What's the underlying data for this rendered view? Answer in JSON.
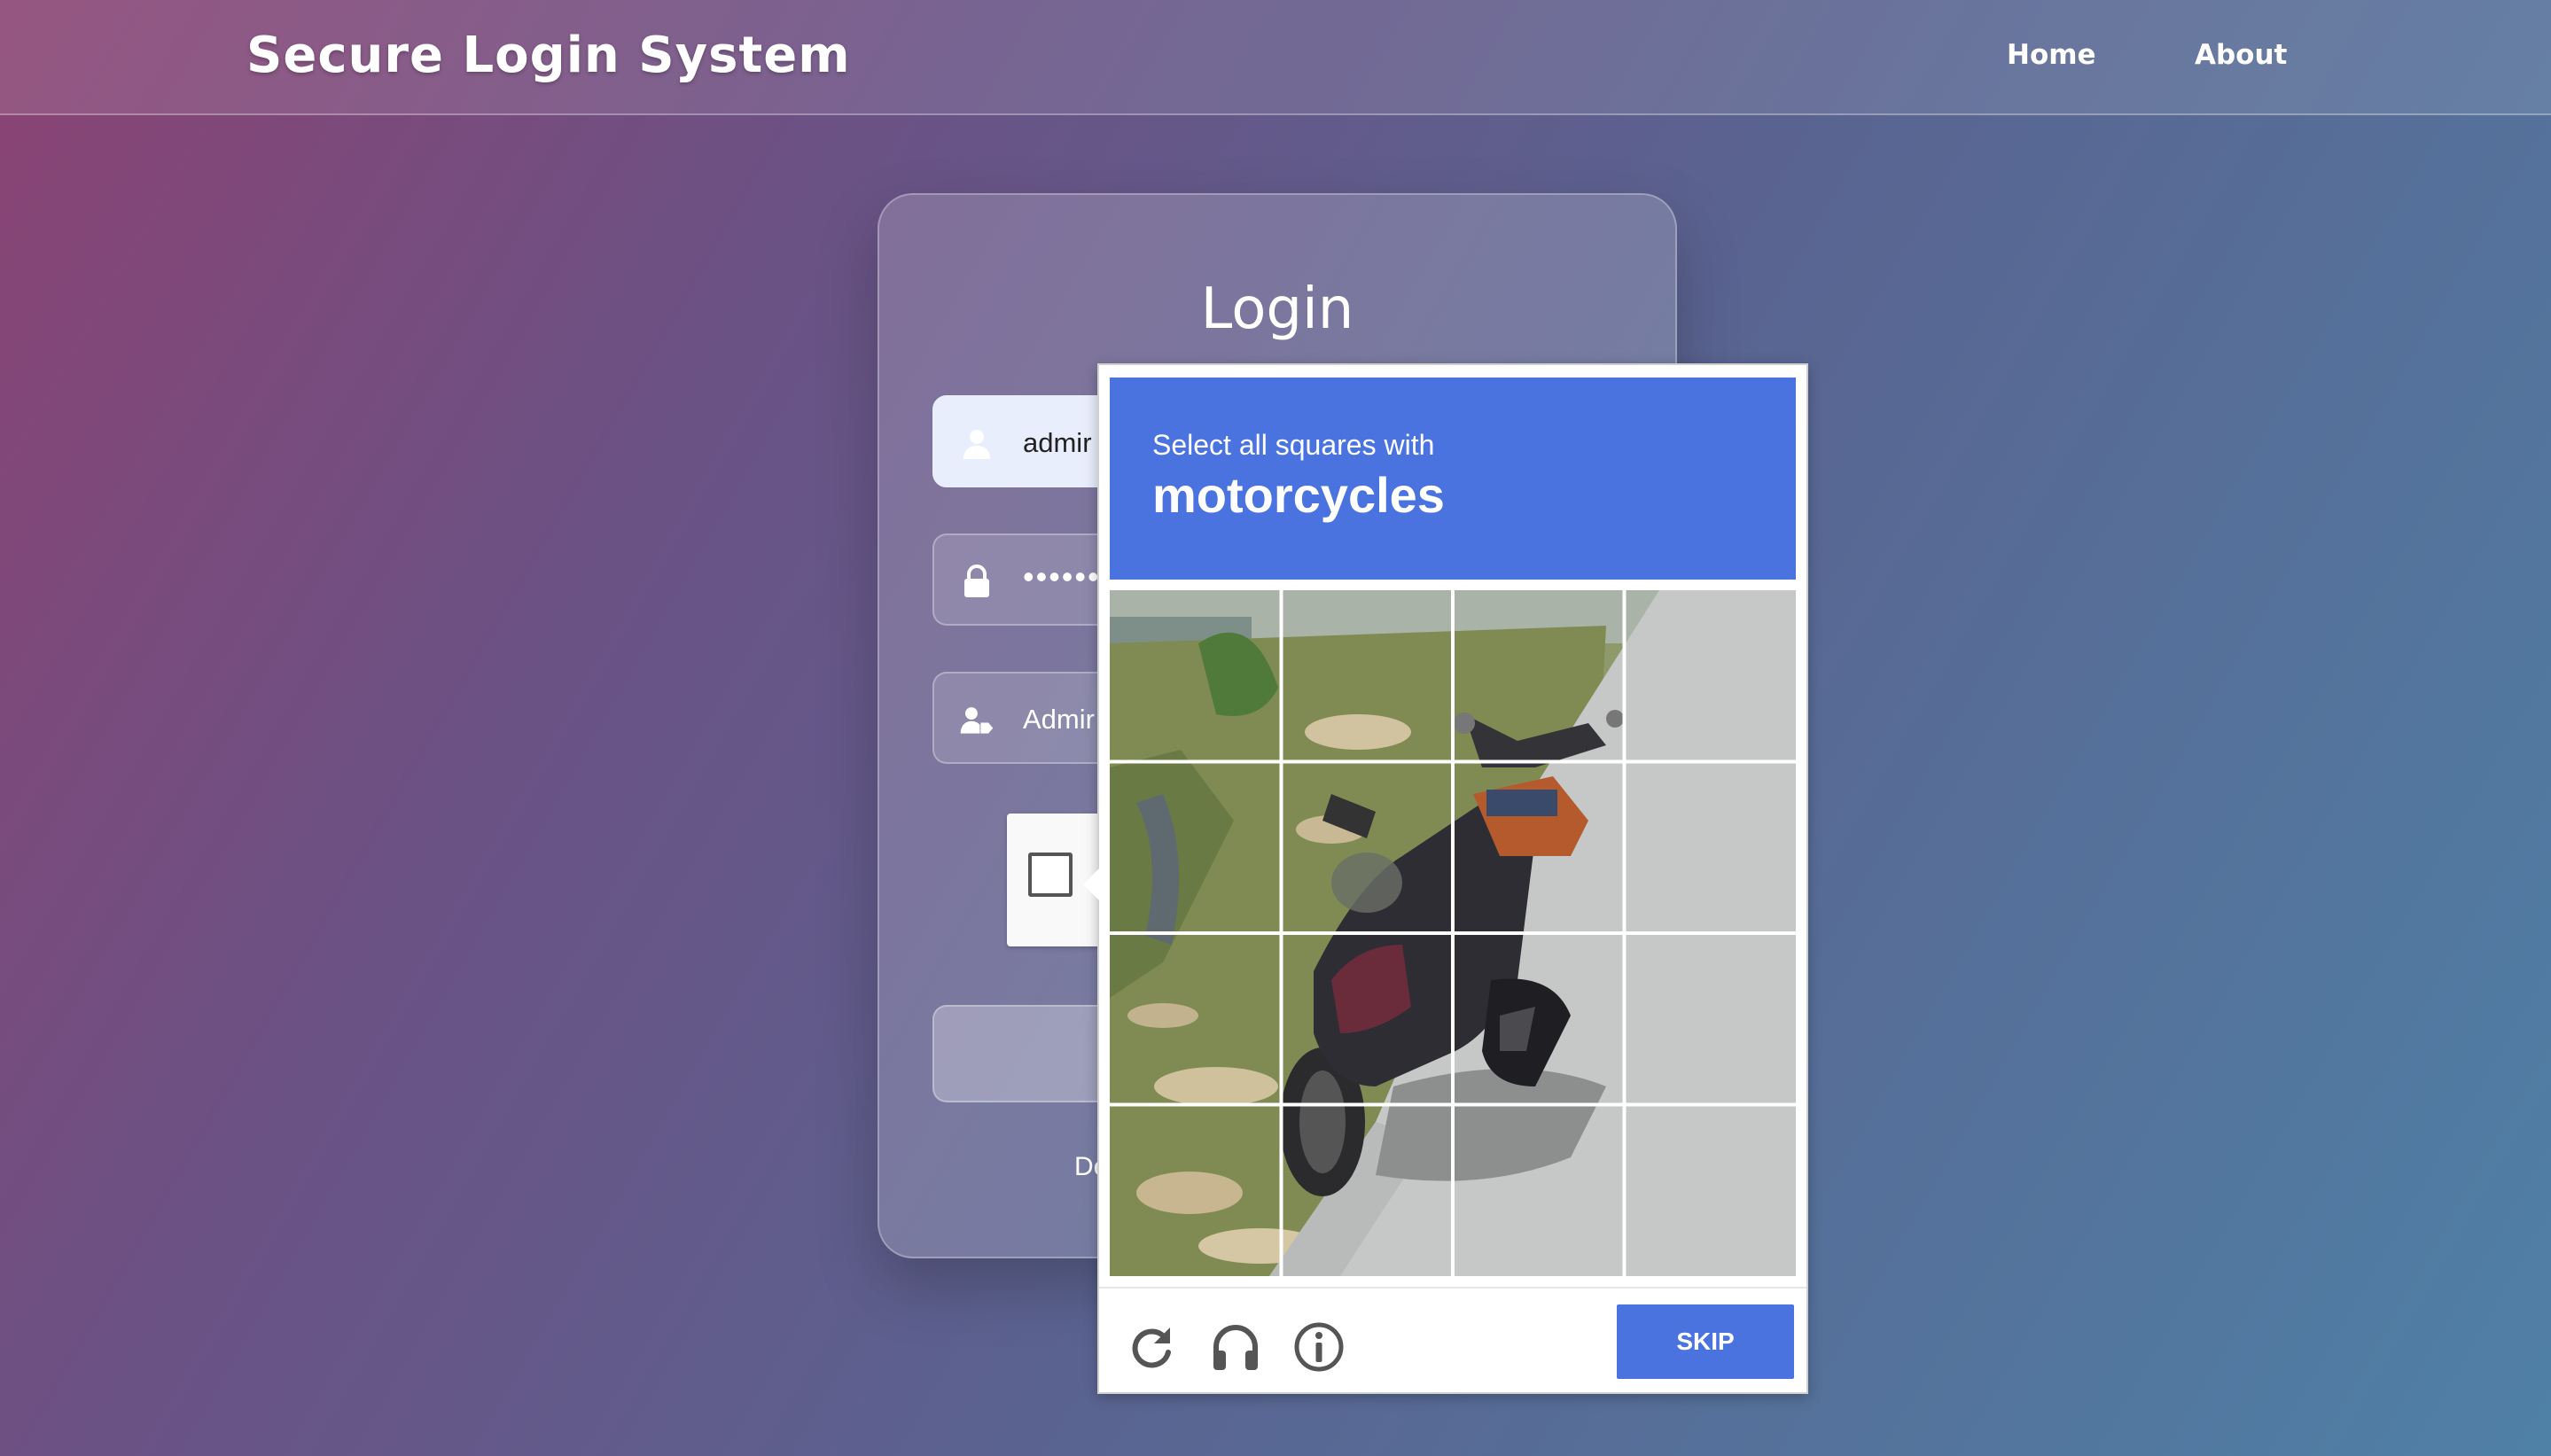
{
  "header": {
    "brand": "Secure Login System",
    "nav": [
      {
        "label": "Home"
      },
      {
        "label": "About"
      }
    ]
  },
  "login": {
    "title": "Login",
    "username_value": "admir",
    "password_value": "•••••••",
    "role_value": "Admir",
    "demo_partial": "De"
  },
  "captcha": {
    "instruction": "Select all squares with",
    "target": "motorcycles",
    "grid_size": 4,
    "skip_label": "SKIP",
    "header_color": "#4a73e0"
  }
}
